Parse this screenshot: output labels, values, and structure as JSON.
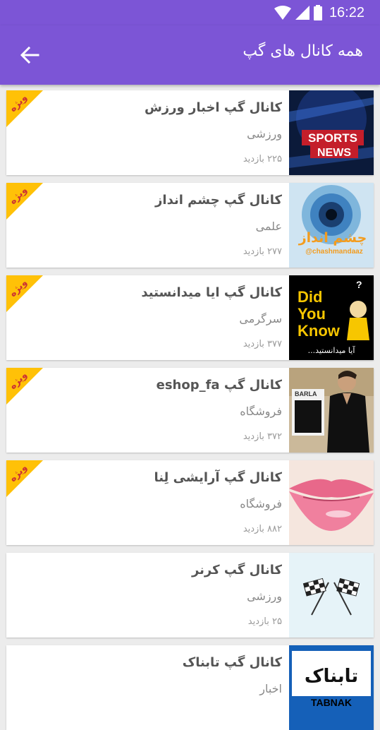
{
  "status_bar": {
    "time": "16:22",
    "icons": [
      "wifi-icon",
      "signal-icon",
      "battery-icon"
    ]
  },
  "app_bar": {
    "title": "همه کانال های گپ",
    "back_icon": "arrow-back-icon"
  },
  "colors": {
    "primary": "#7c55d6",
    "badge": "#ffc107"
  },
  "channels": [
    {
      "title": "کانال گپ اخبار ورزش",
      "category": "ورزشی",
      "views": "۲۲۵ بازدید",
      "featured": true,
      "badge_text": "ویژه",
      "thumb": "sports-news",
      "thumb_text": [
        "SPORTS",
        "NEWS"
      ]
    },
    {
      "title": "کانال گپ چشم انداز",
      "category": "علمی",
      "views": "۲۷۷ بازدید",
      "featured": true,
      "badge_text": "ویژه",
      "thumb": "eye",
      "thumb_text": [
        "چشم انداز",
        "@chashmandaaz"
      ]
    },
    {
      "title": "کانال گپ ایا میدانستید",
      "category": "سرگرمی",
      "views": "۳۷۷ بازدید",
      "featured": true,
      "badge_text": "ویژه",
      "thumb": "did-you-know",
      "thumb_text": [
        "Did",
        "You",
        "Know",
        "?",
        "آیا میدانستید..."
      ]
    },
    {
      "title": "کانال گپ eshop_fa",
      "category": "فروشگاه",
      "views": "۳۷۲ بازدید",
      "featured": true,
      "badge_text": "ویژه",
      "thumb": "shop",
      "thumb_text": [
        "BARLA"
      ]
    },
    {
      "title": "کانال گپ آرایشی لِنا",
      "category": "فروشگاه",
      "views": "۸۸۲ بازدید",
      "featured": true,
      "badge_text": "ویژه",
      "thumb": "lips",
      "thumb_text": []
    },
    {
      "title": "کانال گپ کرنر",
      "category": "ورزشی",
      "views": "۲۵ بازدید",
      "featured": false,
      "badge_text": "",
      "thumb": "flags",
      "thumb_text": []
    },
    {
      "title": "کانال گپ تابناک",
      "category": "اخبار",
      "views": "",
      "featured": false,
      "badge_text": "",
      "thumb": "tabnak",
      "thumb_text": [
        "تابناک",
        "TABNAK"
      ]
    }
  ]
}
